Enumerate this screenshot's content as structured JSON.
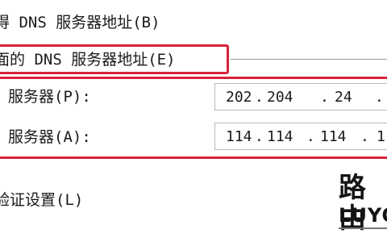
{
  "options": {
    "obtain_dns_auto": "得 DNS 服务器地址(B)",
    "use_following_dns": "面的 DNS 服务器地址(E)",
    "validate_on_exit": "验证设置(L)"
  },
  "dns": {
    "preferred_label": "服务器(P):",
    "preferred_octets": [
      "202",
      "204",
      "24",
      ""
    ],
    "alternate_label": "服务器(A):",
    "alternate_octets": [
      "114",
      "114",
      "114",
      "1"
    ]
  },
  "watermark": {
    "logo_text": "路由",
    "logo_sub": "LUYO"
  },
  "colors": {
    "highlight": "#d9233b"
  }
}
